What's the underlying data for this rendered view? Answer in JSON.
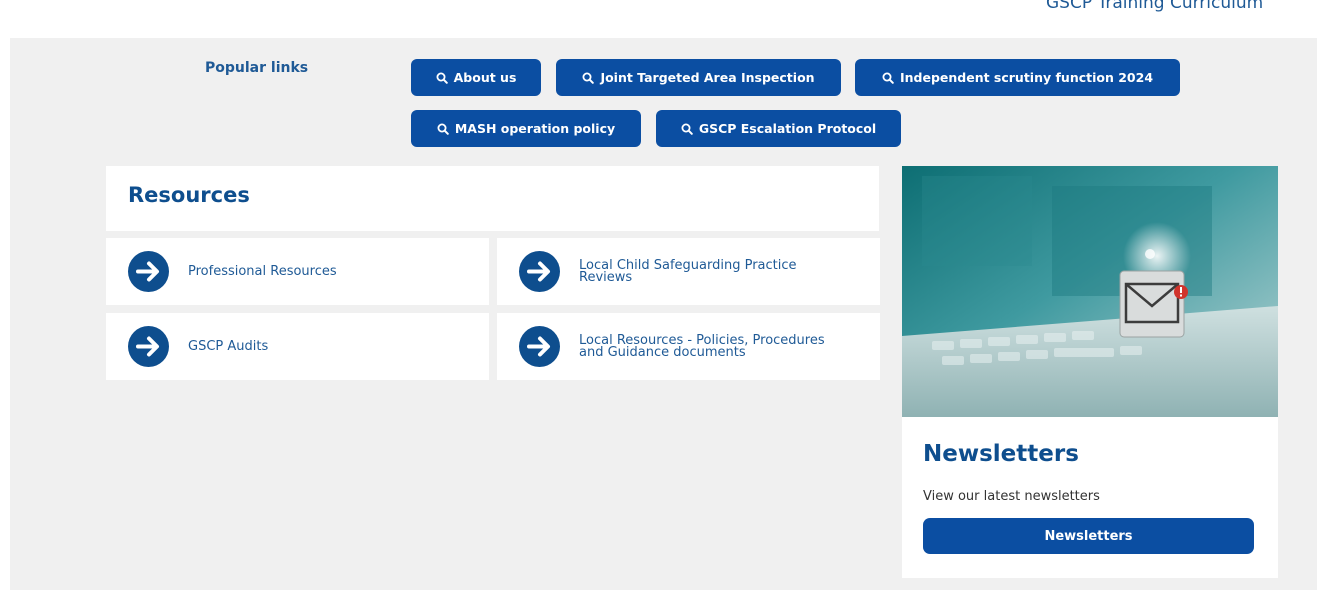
{
  "header": {
    "training_link": "GSCP Training Curriculum"
  },
  "popular_links": {
    "label": "Popular links",
    "items": [
      {
        "label": "About us",
        "icon": "search-icon"
      },
      {
        "label": "Joint Targeted Area Inspection",
        "icon": "search-icon"
      },
      {
        "label": "Independent scrutiny function 2024",
        "icon": "search-icon"
      },
      {
        "label": "MASH operation policy",
        "icon": "search-icon"
      },
      {
        "label": "GSCP Escalation Protocol",
        "icon": "search-icon"
      }
    ]
  },
  "resources": {
    "title": "Resources",
    "items": [
      {
        "label": "Professional Resources",
        "icon": "arrow-right-circle-icon"
      },
      {
        "label": "Local Child Safeguarding Practice Reviews",
        "icon": "arrow-right-circle-icon"
      },
      {
        "label": "GSCP Audits",
        "icon": "arrow-right-circle-icon"
      },
      {
        "label": "Local Resources - Policies, Procedures and Guidance documents",
        "icon": "arrow-right-circle-icon"
      }
    ]
  },
  "newsletters": {
    "title": "Newsletters",
    "description": "View our latest newsletters",
    "button_label": "Newsletters"
  },
  "colors": {
    "brand_blue": "#0b4ea2",
    "heading_blue": "#0e4e8e",
    "panel_gray": "#f0f0f0"
  }
}
